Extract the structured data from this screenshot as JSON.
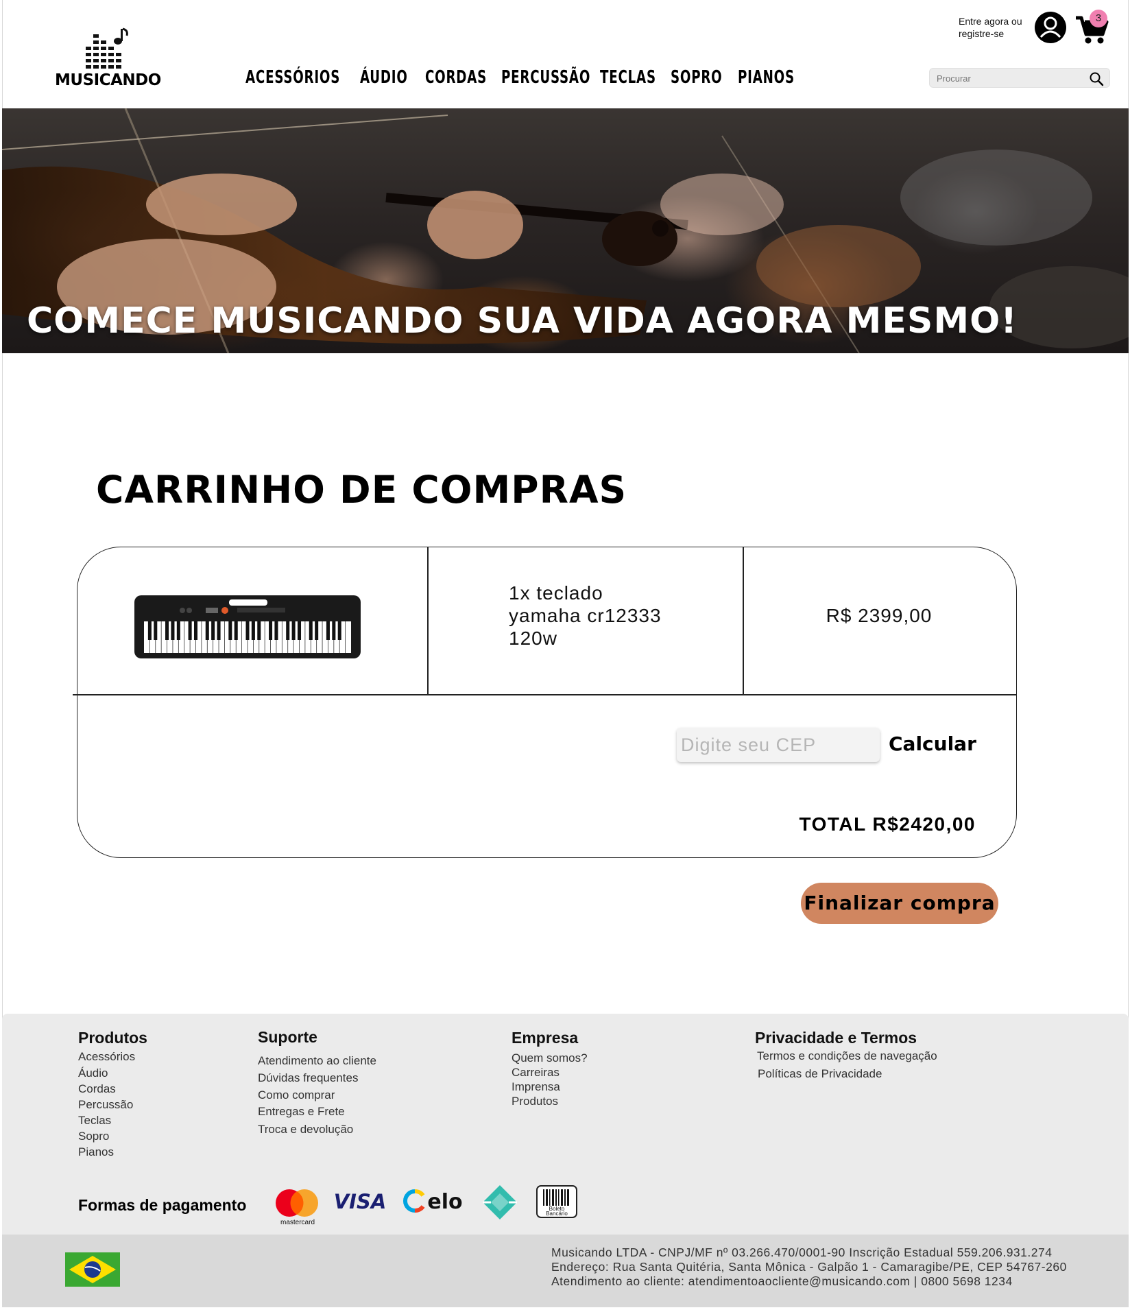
{
  "header": {
    "logo_text": "MUSICANDO",
    "nav": [
      "ACESSÓRIOS",
      "ÁUDIO",
      "CORDAS",
      "PERCUSSÃO",
      "TECLAS",
      "SOPRO",
      "PIANOS"
    ],
    "login_line1": "Entre agora ou",
    "login_line2": "registre-se",
    "cart_count": "3",
    "search_placeholder": "Procurar"
  },
  "hero": {
    "title": "COMECE MUSICANDO SUA VIDA AGORA MESMO!"
  },
  "cart": {
    "title": "CARRINHO DE COMPRAS",
    "item": {
      "name_line1": "1x teclado",
      "name_line2": "yamaha cr12333",
      "name_line3": "120w",
      "price": "R$ 2399,00"
    },
    "cep_placeholder": "Digite seu CEP",
    "calc_label": "Calcular",
    "total": "TOTAL R$2420,00",
    "finish_label": "Finalizar compra"
  },
  "footer": {
    "produtos": {
      "title": "Produtos",
      "links": [
        "Acessórios",
        "Áudio",
        "Cordas",
        "Percussão",
        "Teclas",
        "Sopro",
        "Pianos"
      ]
    },
    "suporte": {
      "title": "Suporte",
      "links": [
        "Atendimento ao cliente",
        "Dúvidas frequentes",
        "Como comprar",
        "Entregas e Frete",
        "Troca e devolução"
      ]
    },
    "empresa": {
      "title": "Empresa",
      "links": [
        "Quem somos?",
        "Carreiras",
        "Imprensa",
        "Produtos"
      ]
    },
    "privacidade": {
      "title": "Privacidade e Termos",
      "links": [
        "Termos e condições de navegação",
        "Políticas de Privacidade"
      ]
    },
    "payment_label": "Formas de pagamento",
    "payment_methods": [
      "mastercard",
      "VISA",
      "elo",
      "pix",
      "Boleto Bancário"
    ],
    "legal": [
      "Musicando LTDA - CNPJ/MF nº 03.266.470/0001-90 Inscrição Estadual 559.206.931.274",
      "Endereço: Rua Santa Quitéria, Santa Mônica - Galpão 1 - Camaragibe/PE, CEP 54767-260",
      "Atendimento ao cliente: atendimentoaocliente@musicando.com | 0800 5698 1234"
    ]
  },
  "colors": {
    "accent_button": "#d08660",
    "cart_badge": "#f07fb0",
    "footer_bg": "#ebebeb",
    "bottom_bar_bg": "#d9d9d9"
  }
}
